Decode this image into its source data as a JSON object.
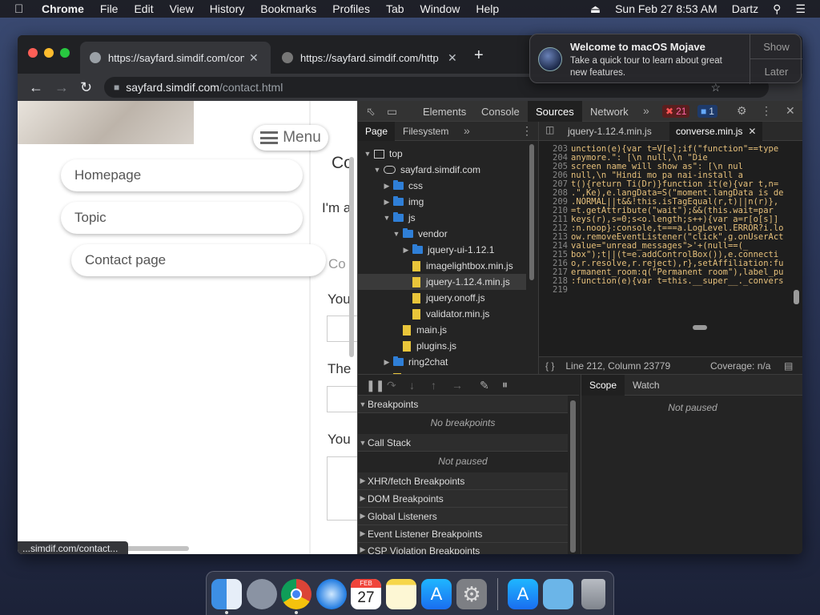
{
  "menubar": {
    "app": "Chrome",
    "items": [
      "File",
      "Edit",
      "View",
      "History",
      "Bookmarks",
      "Profiles",
      "Tab",
      "Window",
      "Help"
    ],
    "datetime": "Sun Feb 27  8:53 AM",
    "user": "Dartz"
  },
  "browser": {
    "tabs": [
      {
        "title": "https://sayfard.simdif.com/con"
      },
      {
        "title": "https://sayfard.simdif.com/http"
      }
    ],
    "address": {
      "host": "sayfard.simdif.com",
      "path": "/contact.html"
    },
    "status_url": "...simdif.com/contact..."
  },
  "webpage": {
    "menu_label": "Menu",
    "nav_items": [
      "Homepage",
      "Topic",
      "Contact page"
    ],
    "fragments": [
      "Co",
      "I'm a",
      "Co",
      "You",
      "The",
      "You"
    ]
  },
  "devtools": {
    "tabs": [
      "Elements",
      "Console",
      "Sources",
      "Network"
    ],
    "errors": "21",
    "messages": "1",
    "nav_tabs": [
      "Page",
      "Filesystem"
    ],
    "tree": [
      {
        "label": "top",
        "kind": "frame",
        "depth": 0,
        "arrow": "down"
      },
      {
        "label": "sayfard.simdif.com",
        "kind": "cloud",
        "depth": 1,
        "arrow": "down"
      },
      {
        "label": "css",
        "kind": "folder",
        "depth": 2,
        "arrow": "right"
      },
      {
        "label": "img",
        "kind": "folder",
        "depth": 2,
        "arrow": "right"
      },
      {
        "label": "js",
        "kind": "folder",
        "depth": 2,
        "arrow": "down"
      },
      {
        "label": "vendor",
        "kind": "folder",
        "depth": 3,
        "arrow": "down"
      },
      {
        "label": "jquery-ui-1.12.1",
        "kind": "folder",
        "depth": 4,
        "arrow": "right"
      },
      {
        "label": "imagelightbox.min.js",
        "kind": "file",
        "depth": 4,
        "arrow": ""
      },
      {
        "label": "jquery-1.12.4.min.js",
        "kind": "file",
        "depth": 4,
        "arrow": "",
        "selected": true
      },
      {
        "label": "jquery.onoff.js",
        "kind": "file",
        "depth": 4,
        "arrow": ""
      },
      {
        "label": "validator.min.js",
        "kind": "file",
        "depth": 4,
        "arrow": ""
      },
      {
        "label": "main.js",
        "kind": "file",
        "depth": 3,
        "arrow": ""
      },
      {
        "label": "plugins.js",
        "kind": "file",
        "depth": 3,
        "arrow": ""
      },
      {
        "label": "ring2chat",
        "kind": "folder",
        "depth": 2,
        "arrow": "right"
      },
      {
        "label": "contact.html",
        "kind": "file",
        "depth": 2,
        "arrow": ""
      }
    ],
    "editor_tabs": [
      "jquery-1.12.4.min.js",
      "converse.min.js"
    ],
    "code_lines": [
      {
        "n": "203",
        "t": "unction(e){var t=V[e];if(\"function\"==type"
      },
      {
        "n": "204",
        "t": "anymore.\": [\\n        null,\\n        \"Die"
      },
      {
        "n": "205",
        "t": " screen name will show as\": [\\n       nul"
      },
      {
        "n": "206",
        "t": "null,\\n        \"Hindi mo pa nai-install a"
      },
      {
        "n": "207",
        "t": "t(){return Ti(Dr)}function it(e){var t,n="
      },
      {
        "n": "208",
        "t": ".\",Ke),e.langData=S(\"moment.langData is de"
      },
      {
        "n": "209",
        "t": ".NORMAL||t&&!this.isTagEqual(r,t)||n(r)},"
      },
      {
        "n": "210",
        "t": "=t.getAttribute(\"wait\");&&(this.wait=par"
      },
      {
        "n": "211",
        "t": "keys(r),s=0;s<o.length;s++){var a=r[o[s]]"
      },
      {
        "n": "212",
        "t": ":n.noop}:console,t===a.LogLevel.ERROR?i.lo"
      },
      {
        "n": "213",
        "t": "ow.removeEventListener(\"click\",g.onUserAct"
      },
      {
        "n": "214",
        "t": "       value=\"unread_messages\">'+(null==(_"
      },
      {
        "n": "215",
        "t": "box\");t||(t=e.addControlBox()),e.connecti"
      },
      {
        "n": "216",
        "t": "o,r.resolve,r.reject),r},setAffiliation:fu"
      },
      {
        "n": "217",
        "t": "ermanent_room:q(\"Permanent room\"),label_pu"
      },
      {
        "n": "218",
        "t": ":function(e){var t=this.__super__._convers"
      },
      {
        "n": "219",
        "t": ""
      }
    ],
    "cursor": "Line 212, Column 23779",
    "coverage": "Coverage: n/a",
    "debugger": {
      "breakpoints": "Breakpoints",
      "no_breakpoints": "No breakpoints",
      "call_stack": "Call Stack",
      "not_paused": "Not paused",
      "sections": [
        "XHR/fetch Breakpoints",
        "DOM Breakpoints",
        "Global Listeners",
        "Event Listener Breakpoints",
        "CSP Violation Breakpoints"
      ],
      "scope_tabs": [
        "Scope",
        "Watch"
      ],
      "scope_status": "Not paused"
    }
  },
  "notification": {
    "title": "Welcome to macOS Mojave",
    "body": "Take a quick tour to learn about great new features.",
    "show": "Show",
    "later": "Later"
  },
  "dock": {
    "calendar_month": "FEB",
    "calendar_day": "27",
    "apps": [
      "Finder",
      "Launchpad",
      "Chrome",
      "Safari",
      "Calendar",
      "Notes",
      "App Store",
      "System Preferences",
      "Apps",
      "Downloads",
      "Trash"
    ]
  }
}
